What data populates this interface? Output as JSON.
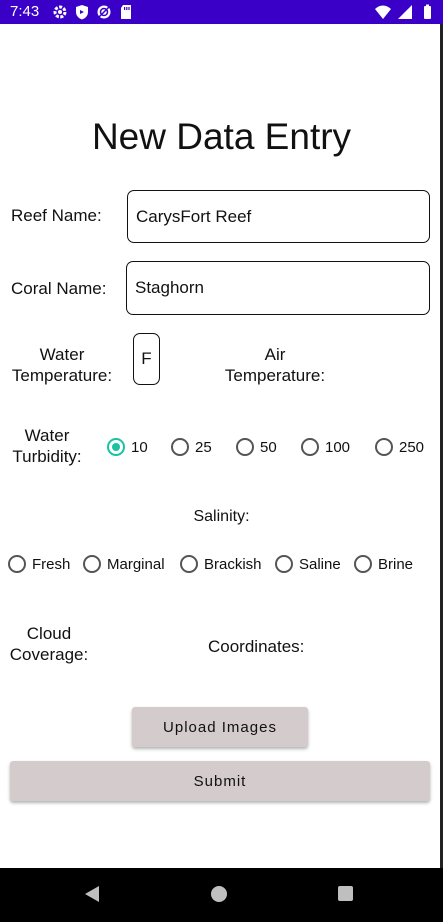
{
  "status_bar": {
    "time": "7:43",
    "background": "#3a00c8",
    "left_icons": [
      "settings-icon",
      "shield-icon",
      "sync-icon",
      "sd-card-icon"
    ],
    "right_icons": [
      "wifi-icon",
      "signal-icon",
      "battery-icon"
    ]
  },
  "form": {
    "title": "New Data Entry",
    "reef_name": {
      "label": "Reef Name:",
      "value": "CarysFort Reef"
    },
    "coral_name": {
      "label": "Coral Name:",
      "value": "Staghorn"
    },
    "water_temperature": {
      "label_line1": "Water",
      "label_line2": "Temperature:",
      "value": "F"
    },
    "air_temperature": {
      "label_line1": "Air",
      "label_line2": "Temperature:"
    },
    "water_turbidity": {
      "label_line1": "Water",
      "label_line2": "Turbidity:",
      "options": [
        "10",
        "25",
        "50",
        "100",
        "250"
      ],
      "selected": "10"
    },
    "salinity": {
      "label": "Salinity:",
      "options": [
        "Fresh",
        "Marginal",
        "Brackish",
        "Saline",
        "Brine"
      ],
      "selected": null
    },
    "cloud_coverage": {
      "label_line1": "Cloud",
      "label_line2": "Coverage:"
    },
    "coordinates": {
      "label": "Coordinates:"
    },
    "upload_images_label": "Upload Images",
    "submit_label": "Submit"
  },
  "colors": {
    "accent": "#18c3a3",
    "button": "#d3cbcc"
  },
  "nav_bar": {
    "icons": [
      "back-icon",
      "home-icon",
      "recent-apps-icon"
    ]
  }
}
